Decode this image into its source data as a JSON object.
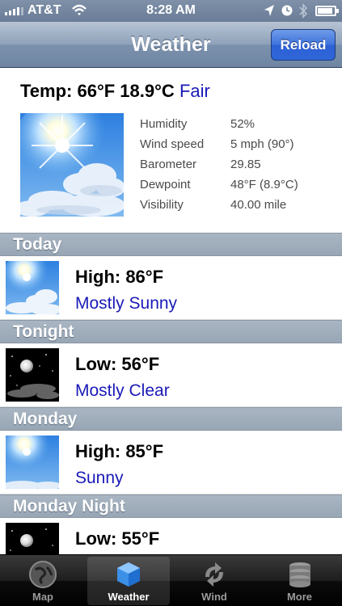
{
  "status_bar": {
    "carrier": "AT&T",
    "time": "8:28 AM"
  },
  "nav": {
    "title": "Weather",
    "reload_label": "Reload"
  },
  "current": {
    "temp_label": "Temp: 66°F 18.9°C",
    "condition": "Fair",
    "icon": "sunny-cloud-icon",
    "details": [
      {
        "label": "Humidity",
        "value": "52%"
      },
      {
        "label": "Wind speed",
        "value": "5 mph (90°)"
      },
      {
        "label": "Barometer",
        "value": "29.85"
      },
      {
        "label": "Dewpoint",
        "value": "48°F (8.9°C)"
      },
      {
        "label": "Visibility",
        "value": "40.00 mile"
      }
    ]
  },
  "forecast": [
    {
      "period": "Today",
      "hilo": "High: 86°F",
      "condition": "Mostly Sunny",
      "icon": "mostly-sunny-icon"
    },
    {
      "period": "Tonight",
      "hilo": "Low: 56°F",
      "condition": "Mostly Clear",
      "icon": "night-moon-icon"
    },
    {
      "period": "Monday",
      "hilo": "High: 85°F",
      "condition": "Sunny",
      "icon": "sunny-icon"
    },
    {
      "period": "Monday Night",
      "hilo": "Low: 55°F",
      "condition": "",
      "icon": "night-moon-icon"
    }
  ],
  "tabs": [
    {
      "label": "Map",
      "icon": "globe-icon",
      "active": false
    },
    {
      "label": "Weather",
      "icon": "cube-icon",
      "active": true
    },
    {
      "label": "Wind",
      "icon": "refresh-arrows-icon",
      "active": false
    },
    {
      "label": "More",
      "icon": "database-stack-icon",
      "active": false
    }
  ],
  "colors": {
    "nav_bar": "#8fa2ba",
    "reload_button": "#3f74dc",
    "condition_text": "#1a1ab8",
    "section_header": "#a9b5c2"
  }
}
